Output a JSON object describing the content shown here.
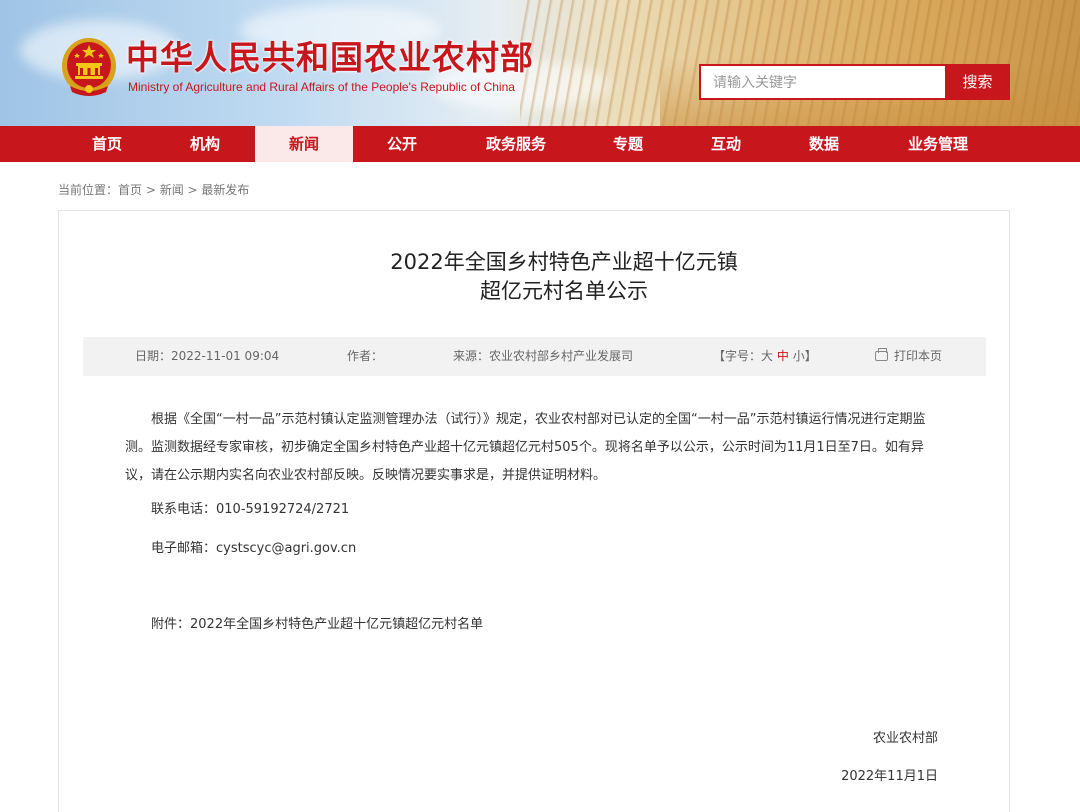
{
  "header": {
    "site_title": "中华人民共和国农业农村部",
    "site_subtitle": "Ministry of Agriculture and Rural Affairs of the People's Republic of China",
    "search_placeholder": "请输入关键字",
    "search_button": "搜索",
    "brand_color": "#c8161d"
  },
  "nav": {
    "items": [
      "首页",
      "机构",
      "新闻",
      "公开",
      "政务服务",
      "专题",
      "互动",
      "数据",
      "业务管理"
    ],
    "active": "新闻"
  },
  "breadcrumb": {
    "prefix": "当前位置：",
    "crumbs": [
      "首页",
      "新闻",
      "最新发布"
    ],
    "separator": " > "
  },
  "article": {
    "title_line1": "2022年全国乡村特色产业超十亿元镇",
    "title_line2": "超亿元村名单公示",
    "meta": {
      "date": "日期：2022-11-01 09:04",
      "author": "作者：",
      "source": "来源：农业农村部乡村产业发展司",
      "font_size_prefix": "【字号：",
      "font_big": "大",
      "font_mid": "中",
      "font_small": "小",
      "font_size_suffix": "】",
      "print": "打印本页"
    },
    "body": "根据《全国“一村一品”示范村镇认定监测管理办法（试行）》规定，农业农村部对已认定的全国“一村一品”示范村镇运行情况进行定期监测。监测数据经专家审核，初步确定全国乡村特色产业超十亿元镇超亿元村505个。现将名单予以公示，公示时间为11月1日至7日。如有异议，请在公示期内实名向农业农村部反映。反映情况要实事求是，并提供证明材料。",
    "phone": "联系电话：010-59192724/2721",
    "email": "电子邮箱：cystscyc@agri.gov.cn",
    "attachment": "附件：2022年全国乡村特色产业超十亿元镇超亿元村名单",
    "signature": "农业农村部",
    "sign_date": "2022年11月1日"
  }
}
